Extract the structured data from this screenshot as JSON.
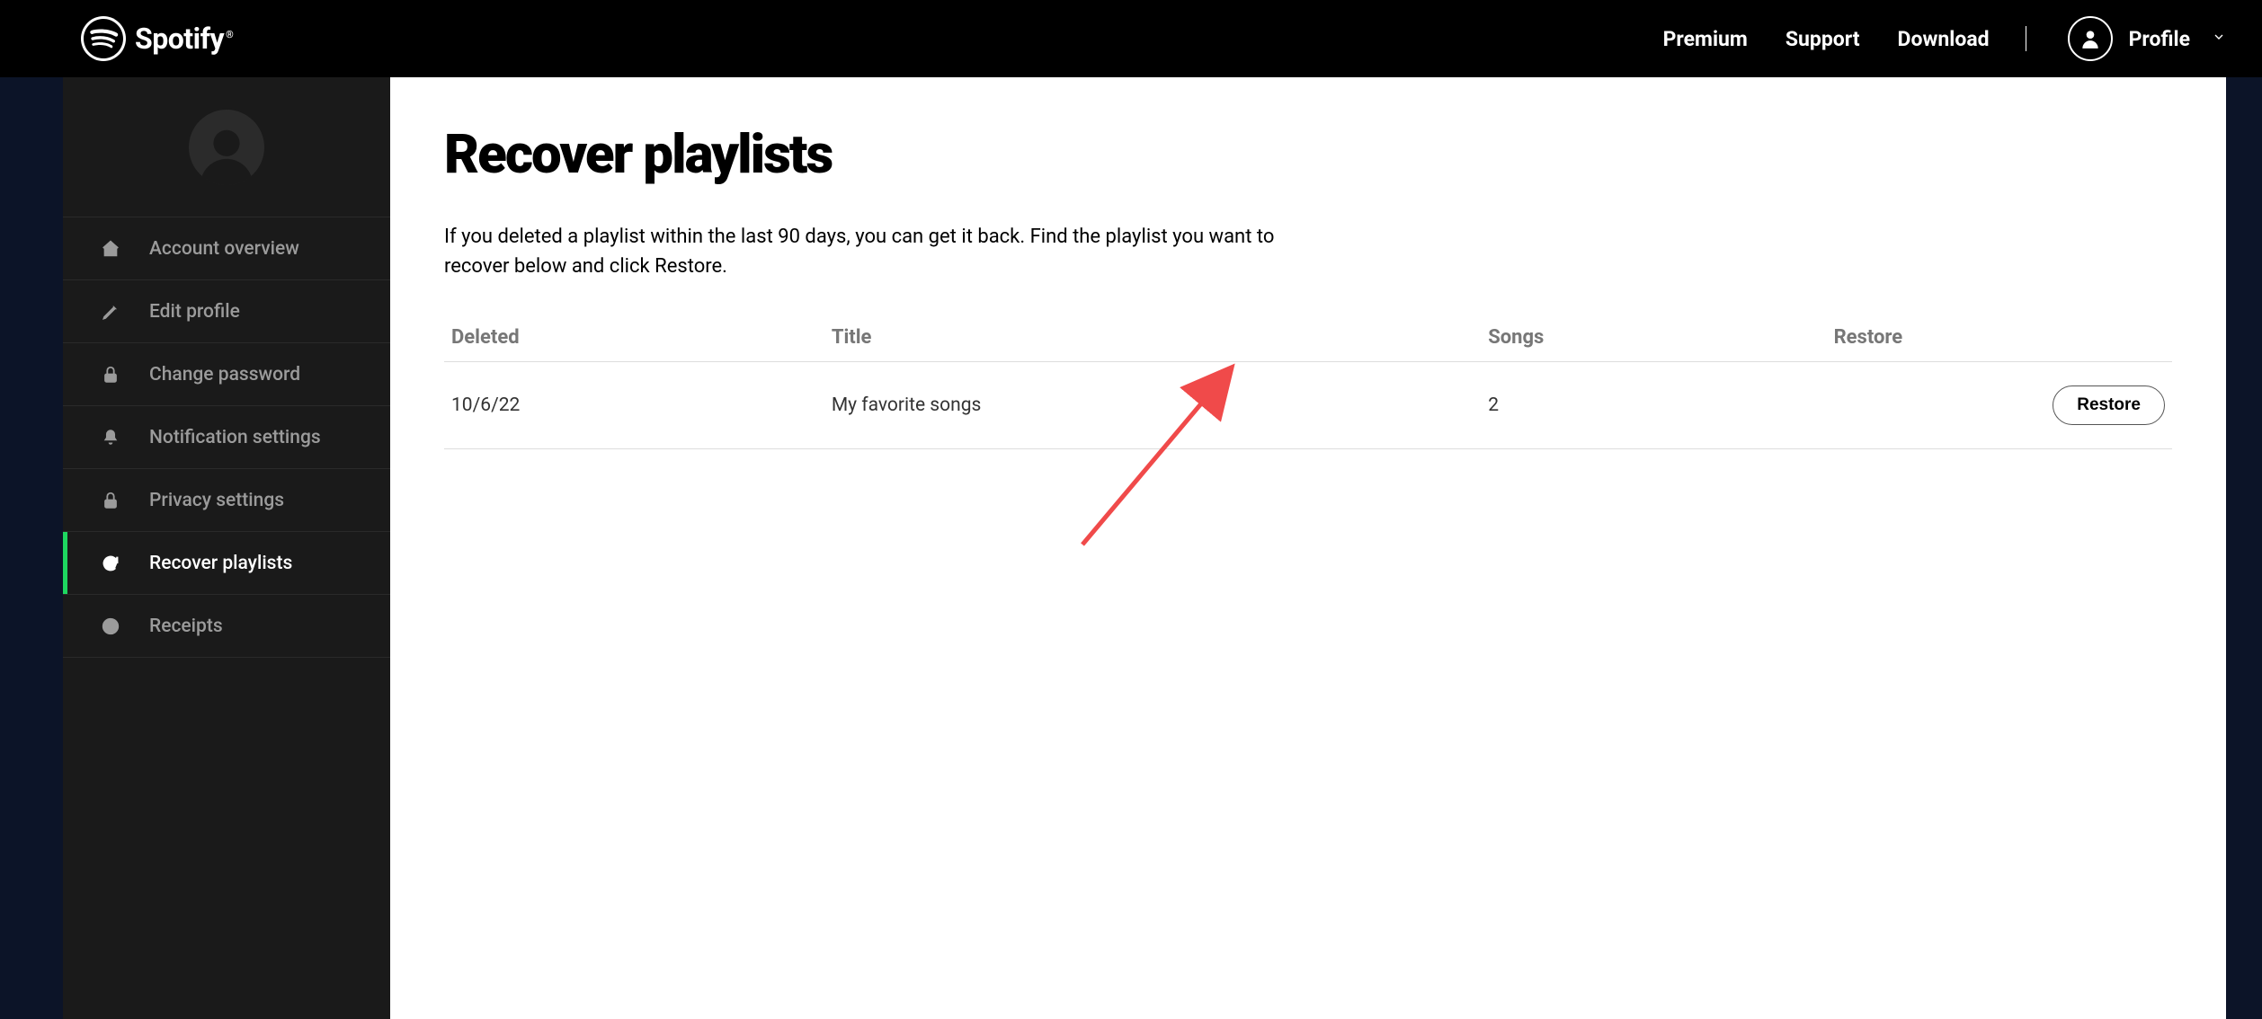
{
  "brand": {
    "name": "Spotify"
  },
  "nav": {
    "premium": "Premium",
    "support": "Support",
    "download": "Download",
    "profile_label": "Profile"
  },
  "sidebar": {
    "items": [
      {
        "id": "account-overview",
        "label": "Account overview",
        "icon": "home-icon",
        "active": false
      },
      {
        "id": "edit-profile",
        "label": "Edit profile",
        "icon": "pencil-icon",
        "active": false
      },
      {
        "id": "change-password",
        "label": "Change password",
        "icon": "lock-icon",
        "active": false
      },
      {
        "id": "notification-settings",
        "label": "Notification settings",
        "icon": "bell-icon",
        "active": false
      },
      {
        "id": "privacy-settings",
        "label": "Privacy settings",
        "icon": "lock-icon",
        "active": false
      },
      {
        "id": "recover-playlists",
        "label": "Recover playlists",
        "icon": "refresh-icon",
        "active": true
      },
      {
        "id": "receipts",
        "label": "Receipts",
        "icon": "clock-icon",
        "active": false
      }
    ]
  },
  "page": {
    "title": "Recover playlists",
    "description": "If you deleted a playlist within the last 90 days, you can get it back. Find the playlist you want to recover below and click Restore."
  },
  "table": {
    "headers": {
      "deleted": "Deleted",
      "title": "Title",
      "songs": "Songs",
      "restore": "Restore"
    },
    "rows": [
      {
        "deleted": "10/6/22",
        "title": "My favorite songs",
        "songs": "2",
        "restore_label": "Restore"
      }
    ]
  },
  "annotation": {
    "target": "restore-button",
    "color": "#f04a4a"
  }
}
